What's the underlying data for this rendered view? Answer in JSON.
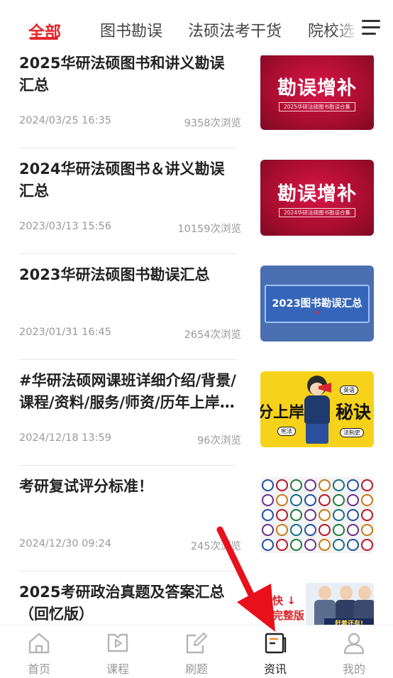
{
  "tabs": [
    {
      "label": "全部",
      "active": true
    },
    {
      "label": "图书勘误",
      "active": false
    },
    {
      "label": "法硕法考干货",
      "active": false
    },
    {
      "label": "院校选",
      "active": false
    }
  ],
  "menu_icon": "hamburger-menu-icon",
  "accent_color": "#e8262c",
  "articles": [
    {
      "title": "2025华研法硕图书和讲义勘误汇总",
      "date": "2024/03/25 16:35",
      "views": "9358次浏览",
      "thumb": {
        "main": "勘误增补",
        "sub": "2025华研法硕图书勘误合集"
      }
    },
    {
      "title": "2024华研法硕图书＆讲义勘误汇总",
      "date": "2023/03/13 15:56",
      "views": "10159次浏览",
      "thumb": {
        "main": "勘误增补",
        "sub": "2024华研法硕图书勘误合集"
      }
    },
    {
      "title": "2023华研法硕图书勘误汇总",
      "date": "2023/01/31 16:45",
      "views": "2654次浏览",
      "thumb": {
        "main": "2023图书勘误汇总"
      }
    },
    {
      "title": "#华研法硕网课班详细介绍/背景/课程/资料/服务/师资/历年上岸率！",
      "date": "2024/12/18 13:59",
      "views": "96次浏览",
      "thumb": {
        "left": "分上岸",
        "right": "秘诀",
        "tag1": "英语",
        "tag2": "宪法",
        "tag3": "法制史"
      }
    },
    {
      "title": "考研复试评分标准！",
      "date": "2024/12/30 09:24",
      "views": "245次浏览",
      "thumb": {}
    },
    {
      "title": "2025考研政治真题及答案汇总（回忆版）",
      "date": "",
      "views": "",
      "thumb": {
        "w1": "最快 ↓",
        "w2": "题完整版",
        "banner": "赶着还有!"
      }
    }
  ],
  "bottom_nav": [
    {
      "label": "首页",
      "icon": "home-icon",
      "active": false
    },
    {
      "label": "课程",
      "icon": "course-play-icon",
      "active": false
    },
    {
      "label": "刷题",
      "icon": "edit-note-icon",
      "active": false
    },
    {
      "label": "资讯",
      "icon": "news-icon",
      "active": true
    },
    {
      "label": "我的",
      "icon": "profile-icon",
      "active": false
    }
  ]
}
